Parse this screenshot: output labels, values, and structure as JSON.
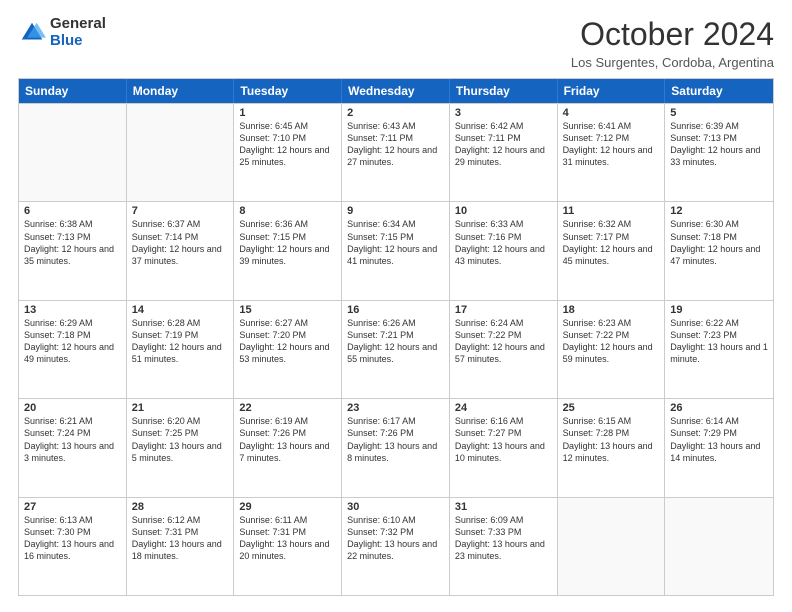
{
  "header": {
    "logo_general": "General",
    "logo_blue": "Blue",
    "month_title": "October 2024",
    "location": "Los Surgentes, Cordoba, Argentina"
  },
  "calendar": {
    "days_of_week": [
      "Sunday",
      "Monday",
      "Tuesday",
      "Wednesday",
      "Thursday",
      "Friday",
      "Saturday"
    ],
    "weeks": [
      [
        {
          "day": "",
          "info": ""
        },
        {
          "day": "",
          "info": ""
        },
        {
          "day": "1",
          "info": "Sunrise: 6:45 AM\nSunset: 7:10 PM\nDaylight: 12 hours and 25 minutes."
        },
        {
          "day": "2",
          "info": "Sunrise: 6:43 AM\nSunset: 7:11 PM\nDaylight: 12 hours and 27 minutes."
        },
        {
          "day": "3",
          "info": "Sunrise: 6:42 AM\nSunset: 7:11 PM\nDaylight: 12 hours and 29 minutes."
        },
        {
          "day": "4",
          "info": "Sunrise: 6:41 AM\nSunset: 7:12 PM\nDaylight: 12 hours and 31 minutes."
        },
        {
          "day": "5",
          "info": "Sunrise: 6:39 AM\nSunset: 7:13 PM\nDaylight: 12 hours and 33 minutes."
        }
      ],
      [
        {
          "day": "6",
          "info": "Sunrise: 6:38 AM\nSunset: 7:13 PM\nDaylight: 12 hours and 35 minutes."
        },
        {
          "day": "7",
          "info": "Sunrise: 6:37 AM\nSunset: 7:14 PM\nDaylight: 12 hours and 37 minutes."
        },
        {
          "day": "8",
          "info": "Sunrise: 6:36 AM\nSunset: 7:15 PM\nDaylight: 12 hours and 39 minutes."
        },
        {
          "day": "9",
          "info": "Sunrise: 6:34 AM\nSunset: 7:15 PM\nDaylight: 12 hours and 41 minutes."
        },
        {
          "day": "10",
          "info": "Sunrise: 6:33 AM\nSunset: 7:16 PM\nDaylight: 12 hours and 43 minutes."
        },
        {
          "day": "11",
          "info": "Sunrise: 6:32 AM\nSunset: 7:17 PM\nDaylight: 12 hours and 45 minutes."
        },
        {
          "day": "12",
          "info": "Sunrise: 6:30 AM\nSunset: 7:18 PM\nDaylight: 12 hours and 47 minutes."
        }
      ],
      [
        {
          "day": "13",
          "info": "Sunrise: 6:29 AM\nSunset: 7:18 PM\nDaylight: 12 hours and 49 minutes."
        },
        {
          "day": "14",
          "info": "Sunrise: 6:28 AM\nSunset: 7:19 PM\nDaylight: 12 hours and 51 minutes."
        },
        {
          "day": "15",
          "info": "Sunrise: 6:27 AM\nSunset: 7:20 PM\nDaylight: 12 hours and 53 minutes."
        },
        {
          "day": "16",
          "info": "Sunrise: 6:26 AM\nSunset: 7:21 PM\nDaylight: 12 hours and 55 minutes."
        },
        {
          "day": "17",
          "info": "Sunrise: 6:24 AM\nSunset: 7:22 PM\nDaylight: 12 hours and 57 minutes."
        },
        {
          "day": "18",
          "info": "Sunrise: 6:23 AM\nSunset: 7:22 PM\nDaylight: 12 hours and 59 minutes."
        },
        {
          "day": "19",
          "info": "Sunrise: 6:22 AM\nSunset: 7:23 PM\nDaylight: 13 hours and 1 minute."
        }
      ],
      [
        {
          "day": "20",
          "info": "Sunrise: 6:21 AM\nSunset: 7:24 PM\nDaylight: 13 hours and 3 minutes."
        },
        {
          "day": "21",
          "info": "Sunrise: 6:20 AM\nSunset: 7:25 PM\nDaylight: 13 hours and 5 minutes."
        },
        {
          "day": "22",
          "info": "Sunrise: 6:19 AM\nSunset: 7:26 PM\nDaylight: 13 hours and 7 minutes."
        },
        {
          "day": "23",
          "info": "Sunrise: 6:17 AM\nSunset: 7:26 PM\nDaylight: 13 hours and 8 minutes."
        },
        {
          "day": "24",
          "info": "Sunrise: 6:16 AM\nSunset: 7:27 PM\nDaylight: 13 hours and 10 minutes."
        },
        {
          "day": "25",
          "info": "Sunrise: 6:15 AM\nSunset: 7:28 PM\nDaylight: 13 hours and 12 minutes."
        },
        {
          "day": "26",
          "info": "Sunrise: 6:14 AM\nSunset: 7:29 PM\nDaylight: 13 hours and 14 minutes."
        }
      ],
      [
        {
          "day": "27",
          "info": "Sunrise: 6:13 AM\nSunset: 7:30 PM\nDaylight: 13 hours and 16 minutes."
        },
        {
          "day": "28",
          "info": "Sunrise: 6:12 AM\nSunset: 7:31 PM\nDaylight: 13 hours and 18 minutes."
        },
        {
          "day": "29",
          "info": "Sunrise: 6:11 AM\nSunset: 7:31 PM\nDaylight: 13 hours and 20 minutes."
        },
        {
          "day": "30",
          "info": "Sunrise: 6:10 AM\nSunset: 7:32 PM\nDaylight: 13 hours and 22 minutes."
        },
        {
          "day": "31",
          "info": "Sunrise: 6:09 AM\nSunset: 7:33 PM\nDaylight: 13 hours and 23 minutes."
        },
        {
          "day": "",
          "info": ""
        },
        {
          "day": "",
          "info": ""
        }
      ]
    ]
  }
}
